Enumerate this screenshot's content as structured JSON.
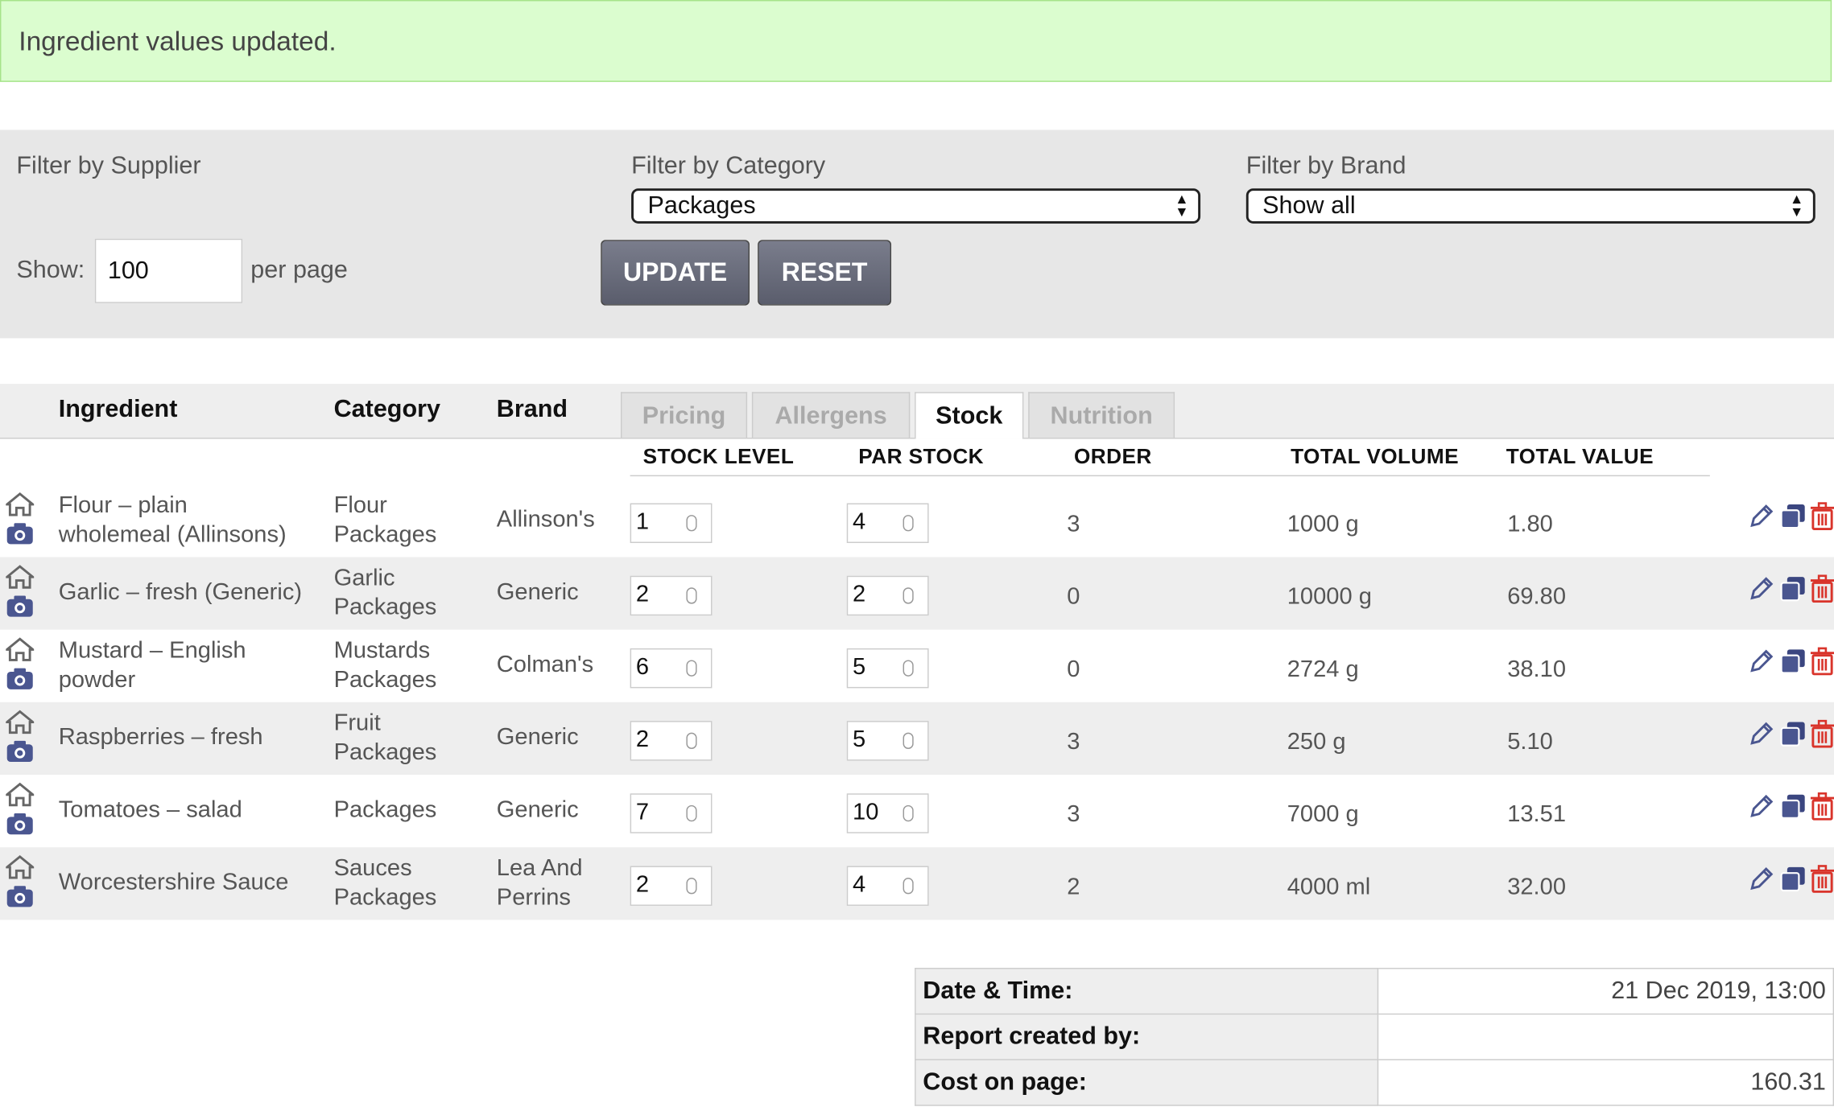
{
  "notice": {
    "message": "Ingredient values updated."
  },
  "filters": {
    "supplier_label": "Filter by Supplier",
    "category_label": "Filter by Category",
    "category_value": "Packages",
    "brand_label": "Filter by Brand",
    "brand_value": "Show all",
    "show_label": "Show:",
    "show_value": "100",
    "per_page_label": "per page",
    "update_label": "UPDATE",
    "reset_label": "RESET"
  },
  "table": {
    "headers": {
      "ingredient": "Ingredient",
      "category": "Category",
      "brand": "Brand"
    },
    "tabs": [
      {
        "label": "Pricing",
        "active": false
      },
      {
        "label": "Allergens",
        "active": false
      },
      {
        "label": "Stock",
        "active": true
      },
      {
        "label": "Nutrition",
        "active": false
      }
    ],
    "stock_columns": {
      "stock_level": "STOCK LEVEL",
      "par_stock": "PAR STOCK",
      "order": "ORDER",
      "total_volume": "TOTAL VOLUME",
      "total_value": "TOTAL VALUE"
    },
    "rows": [
      {
        "ingredient_1": "Flour – plain",
        "ingredient_2": "wholemeal (Allinsons)",
        "category_1": "Flour",
        "category_2": "Packages",
        "brand_1": "Allinson's",
        "brand_2": "",
        "stock_level": "1",
        "par_stock": "4",
        "order": "3",
        "total_volume": "1000 g",
        "total_value": "1.80"
      },
      {
        "ingredient_1": "Garlic – fresh (Generic)",
        "ingredient_2": "",
        "category_1": "Garlic",
        "category_2": "Packages",
        "brand_1": "Generic",
        "brand_2": "",
        "stock_level": "2",
        "par_stock": "2",
        "order": "0",
        "total_volume": "10000 g",
        "total_value": "69.80"
      },
      {
        "ingredient_1": "Mustard – English",
        "ingredient_2": "powder",
        "category_1": "Mustards",
        "category_2": "Packages",
        "brand_1": "Colman's",
        "brand_2": "",
        "stock_level": "6",
        "par_stock": "5",
        "order": "0",
        "total_volume": "2724 g",
        "total_value": "38.10"
      },
      {
        "ingredient_1": "Raspberries – fresh",
        "ingredient_2": "",
        "category_1": "Fruit",
        "category_2": "Packages",
        "brand_1": "Generic",
        "brand_2": "",
        "stock_level": "2",
        "par_stock": "5",
        "order": "3",
        "total_volume": "250 g",
        "total_value": "5.10"
      },
      {
        "ingredient_1": "Tomatoes – salad",
        "ingredient_2": "",
        "category_1": "Packages",
        "category_2": "",
        "brand_1": "Generic",
        "brand_2": "",
        "stock_level": "7",
        "par_stock": "10",
        "order": "3",
        "total_volume": "7000 g",
        "total_value": "13.51"
      },
      {
        "ingredient_1": "Worcestershire Sauce",
        "ingredient_2": "",
        "category_1": "Sauces",
        "category_2": "Packages",
        "brand_1": "Lea And",
        "brand_2": "Perrins",
        "stock_level": "2",
        "par_stock": "4",
        "order": "2",
        "total_volume": "4000 ml",
        "total_value": "32.00"
      }
    ]
  },
  "summary": {
    "date_label": "Date & Time:",
    "date_value": "21 Dec 2019, 13:00",
    "created_label": "Report created by:",
    "created_value": "",
    "cost_label": "Cost on page:",
    "cost_value": "160.31"
  },
  "icons": {
    "home": "home-icon",
    "camera": "camera-icon",
    "edit": "pencil-icon",
    "copy": "copy-icon",
    "delete": "trash-icon"
  },
  "colors": {
    "notice_bg": "#dbfdcf",
    "button_bg": "#6a6d7c",
    "icon_blue": "#4a5690",
    "delete_red": "#d9342b"
  }
}
